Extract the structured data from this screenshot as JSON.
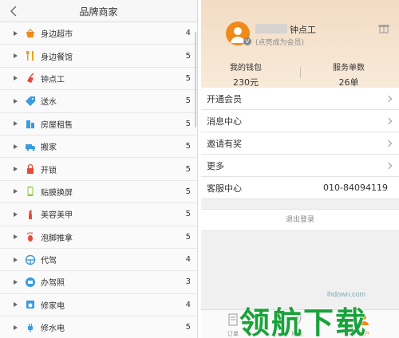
{
  "left": {
    "title": "品牌商家",
    "categories": [
      {
        "label": "身边超市",
        "count": "4",
        "icon": "basket-icon"
      },
      {
        "label": "身边餐馆",
        "count": "5",
        "icon": "utensils-icon"
      },
      {
        "label": "钟点工",
        "count": "5",
        "icon": "broom-icon"
      },
      {
        "label": "送水",
        "count": "5",
        "icon": "water-tag-icon"
      },
      {
        "label": "房屋租售",
        "count": "5",
        "icon": "building-icon"
      },
      {
        "label": "搬家",
        "count": "5",
        "icon": "truck-icon"
      },
      {
        "label": "开锁",
        "count": "5",
        "icon": "lock-icon"
      },
      {
        "label": "贴膜换屏",
        "count": "5",
        "icon": "phone-icon"
      },
      {
        "label": "美容美甲",
        "count": "5",
        "icon": "lipstick-icon"
      },
      {
        "label": "泡脚推拿",
        "count": "5",
        "icon": "foot-icon"
      },
      {
        "label": "代驾",
        "count": "4",
        "icon": "steering-wheel-icon"
      },
      {
        "label": "办驾照",
        "count": "3",
        "icon": "license-icon"
      },
      {
        "label": "修家电",
        "count": "4",
        "icon": "appliance-icon"
      },
      {
        "label": "修水电",
        "count": "5",
        "icon": "plug-icon"
      }
    ]
  },
  "right": {
    "user_name": "钟点工",
    "user_sub": "(点亮成为会员)",
    "wallet_label": "我的钱包",
    "wallet_value": "230元",
    "orders_label": "服务单数",
    "orders_value": "26单",
    "menu": [
      {
        "label": "开通会员"
      },
      {
        "label": "消息中心"
      },
      {
        "label": "邀请有奖"
      },
      {
        "label": "更多"
      }
    ],
    "service_label": "客服中心",
    "service_phone": "010-84094119",
    "logout_label": "退出登录",
    "tabs": [
      {
        "label": "订单"
      },
      {
        "label": "地图"
      },
      {
        "label": "账户"
      }
    ]
  },
  "colors": {
    "accent": "#f08a1a",
    "header_bg": "#f3dcc4",
    "watermark": "#1aa23a"
  },
  "watermark": {
    "logo": "领航下载",
    "domain": "lhdown.com"
  }
}
